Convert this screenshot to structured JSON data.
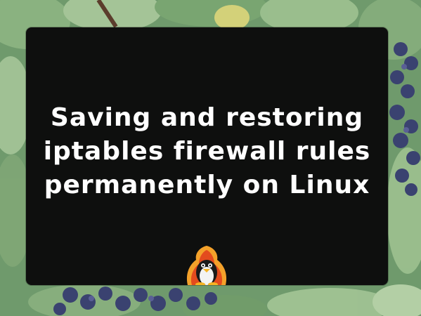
{
  "title_lines": [
    "Saving and restoring",
    "iptables firewall rules",
    "permanently on Linux"
  ],
  "colors": {
    "card_background": "#0e0f0e",
    "title_text": "#ffffff",
    "foliage": "#5f8f63",
    "grapes": "#3a4270"
  },
  "icons": {
    "mascot": "tux-penguin-flame-icon"
  }
}
